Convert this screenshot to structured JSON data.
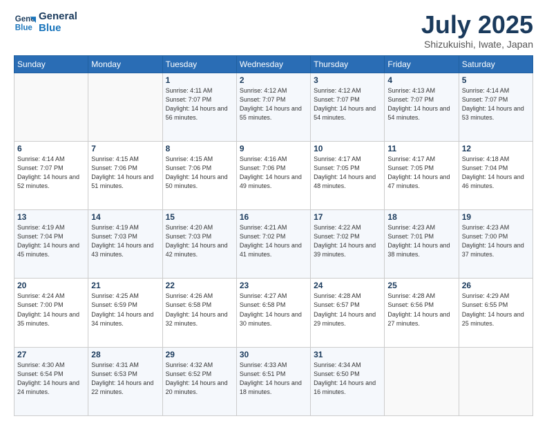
{
  "header": {
    "logo_line1": "General",
    "logo_line2": "Blue",
    "month": "July 2025",
    "location": "Shizukuishi, Iwate, Japan"
  },
  "weekdays": [
    "Sunday",
    "Monday",
    "Tuesday",
    "Wednesday",
    "Thursday",
    "Friday",
    "Saturday"
  ],
  "weeks": [
    [
      {
        "day": "",
        "info": ""
      },
      {
        "day": "",
        "info": ""
      },
      {
        "day": "1",
        "info": "Sunrise: 4:11 AM\nSunset: 7:07 PM\nDaylight: 14 hours and 56 minutes."
      },
      {
        "day": "2",
        "info": "Sunrise: 4:12 AM\nSunset: 7:07 PM\nDaylight: 14 hours and 55 minutes."
      },
      {
        "day": "3",
        "info": "Sunrise: 4:12 AM\nSunset: 7:07 PM\nDaylight: 14 hours and 54 minutes."
      },
      {
        "day": "4",
        "info": "Sunrise: 4:13 AM\nSunset: 7:07 PM\nDaylight: 14 hours and 54 minutes."
      },
      {
        "day": "5",
        "info": "Sunrise: 4:14 AM\nSunset: 7:07 PM\nDaylight: 14 hours and 53 minutes."
      }
    ],
    [
      {
        "day": "6",
        "info": "Sunrise: 4:14 AM\nSunset: 7:07 PM\nDaylight: 14 hours and 52 minutes."
      },
      {
        "day": "7",
        "info": "Sunrise: 4:15 AM\nSunset: 7:06 PM\nDaylight: 14 hours and 51 minutes."
      },
      {
        "day": "8",
        "info": "Sunrise: 4:15 AM\nSunset: 7:06 PM\nDaylight: 14 hours and 50 minutes."
      },
      {
        "day": "9",
        "info": "Sunrise: 4:16 AM\nSunset: 7:06 PM\nDaylight: 14 hours and 49 minutes."
      },
      {
        "day": "10",
        "info": "Sunrise: 4:17 AM\nSunset: 7:05 PM\nDaylight: 14 hours and 48 minutes."
      },
      {
        "day": "11",
        "info": "Sunrise: 4:17 AM\nSunset: 7:05 PM\nDaylight: 14 hours and 47 minutes."
      },
      {
        "day": "12",
        "info": "Sunrise: 4:18 AM\nSunset: 7:04 PM\nDaylight: 14 hours and 46 minutes."
      }
    ],
    [
      {
        "day": "13",
        "info": "Sunrise: 4:19 AM\nSunset: 7:04 PM\nDaylight: 14 hours and 45 minutes."
      },
      {
        "day": "14",
        "info": "Sunrise: 4:19 AM\nSunset: 7:03 PM\nDaylight: 14 hours and 43 minutes."
      },
      {
        "day": "15",
        "info": "Sunrise: 4:20 AM\nSunset: 7:03 PM\nDaylight: 14 hours and 42 minutes."
      },
      {
        "day": "16",
        "info": "Sunrise: 4:21 AM\nSunset: 7:02 PM\nDaylight: 14 hours and 41 minutes."
      },
      {
        "day": "17",
        "info": "Sunrise: 4:22 AM\nSunset: 7:02 PM\nDaylight: 14 hours and 39 minutes."
      },
      {
        "day": "18",
        "info": "Sunrise: 4:23 AM\nSunset: 7:01 PM\nDaylight: 14 hours and 38 minutes."
      },
      {
        "day": "19",
        "info": "Sunrise: 4:23 AM\nSunset: 7:00 PM\nDaylight: 14 hours and 37 minutes."
      }
    ],
    [
      {
        "day": "20",
        "info": "Sunrise: 4:24 AM\nSunset: 7:00 PM\nDaylight: 14 hours and 35 minutes."
      },
      {
        "day": "21",
        "info": "Sunrise: 4:25 AM\nSunset: 6:59 PM\nDaylight: 14 hours and 34 minutes."
      },
      {
        "day": "22",
        "info": "Sunrise: 4:26 AM\nSunset: 6:58 PM\nDaylight: 14 hours and 32 minutes."
      },
      {
        "day": "23",
        "info": "Sunrise: 4:27 AM\nSunset: 6:58 PM\nDaylight: 14 hours and 30 minutes."
      },
      {
        "day": "24",
        "info": "Sunrise: 4:28 AM\nSunset: 6:57 PM\nDaylight: 14 hours and 29 minutes."
      },
      {
        "day": "25",
        "info": "Sunrise: 4:28 AM\nSunset: 6:56 PM\nDaylight: 14 hours and 27 minutes."
      },
      {
        "day": "26",
        "info": "Sunrise: 4:29 AM\nSunset: 6:55 PM\nDaylight: 14 hours and 25 minutes."
      }
    ],
    [
      {
        "day": "27",
        "info": "Sunrise: 4:30 AM\nSunset: 6:54 PM\nDaylight: 14 hours and 24 minutes."
      },
      {
        "day": "28",
        "info": "Sunrise: 4:31 AM\nSunset: 6:53 PM\nDaylight: 14 hours and 22 minutes."
      },
      {
        "day": "29",
        "info": "Sunrise: 4:32 AM\nSunset: 6:52 PM\nDaylight: 14 hours and 20 minutes."
      },
      {
        "day": "30",
        "info": "Sunrise: 4:33 AM\nSunset: 6:51 PM\nDaylight: 14 hours and 18 minutes."
      },
      {
        "day": "31",
        "info": "Sunrise: 4:34 AM\nSunset: 6:50 PM\nDaylight: 14 hours and 16 minutes."
      },
      {
        "day": "",
        "info": ""
      },
      {
        "day": "",
        "info": ""
      }
    ]
  ]
}
